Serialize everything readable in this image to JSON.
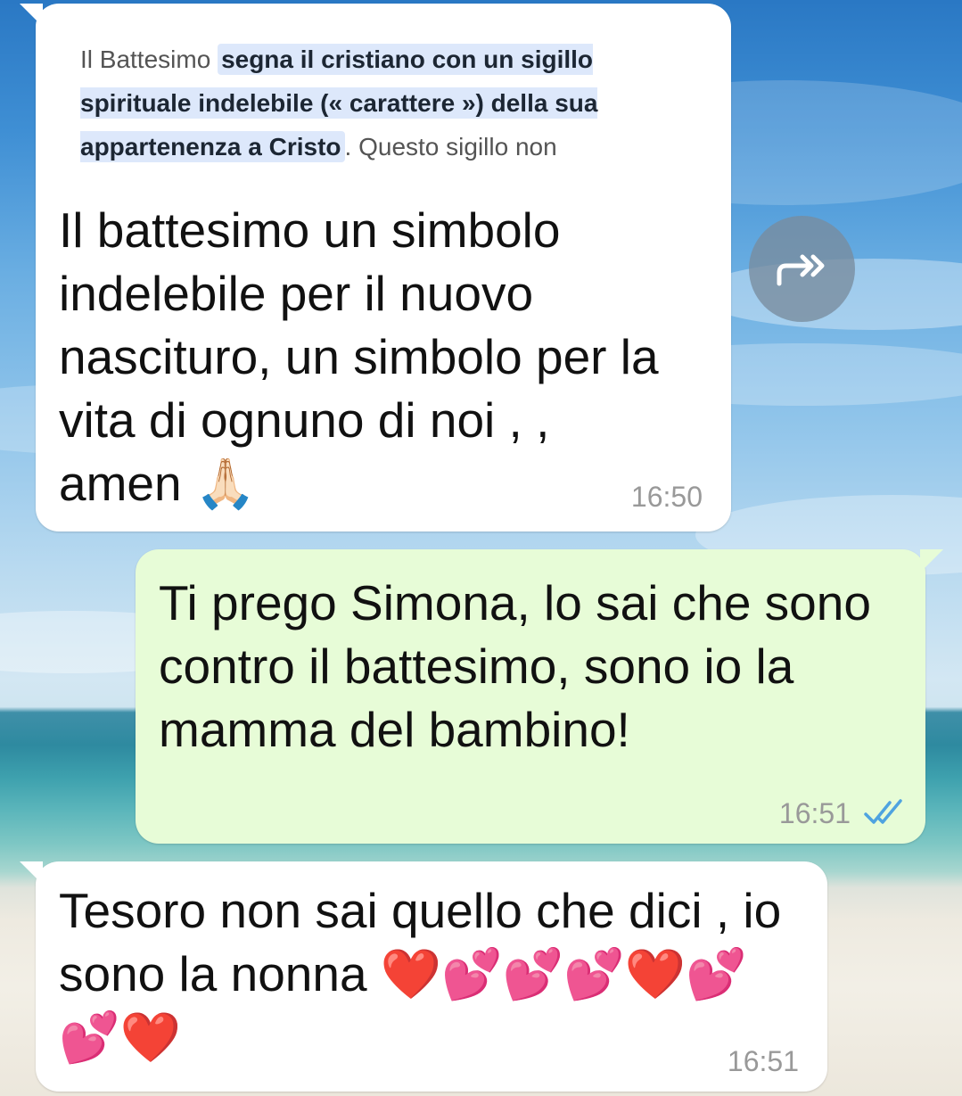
{
  "messages": [
    {
      "quote_plain": "Il Battesimo ",
      "quote_highlight": "segna il cristiano con un sigillo spirituale indelebile (« carattere ») della sua appartenenza a Cristo",
      "quote_tail": ". Questo sigillo non",
      "text": "Il battesimo un simbolo indelebile per il nuovo nascituro, un simbolo per la vita di ognuno di noi , , amen ",
      "emoji": "🙏🏻",
      "time": "16:50"
    },
    {
      "text": "Ti prego Simona, lo sai che sono contro il battesimo, sono io la mamma del bambino!",
      "time": "16:51",
      "status_icon": "double-check-read-icon"
    },
    {
      "text": "Tesoro non sai quello che dici , io sono la nonna ",
      "emoji": "❤️💕💕💕❤️💕💕❤️",
      "time": "16:51"
    }
  ],
  "colors": {
    "incoming_bubble": "#ffffff",
    "outgoing_bubble": "#e7fcd7",
    "read_check": "#4fa3e0",
    "highlight": "#dde8fb"
  },
  "icons": {
    "forward": "forward-icon"
  }
}
